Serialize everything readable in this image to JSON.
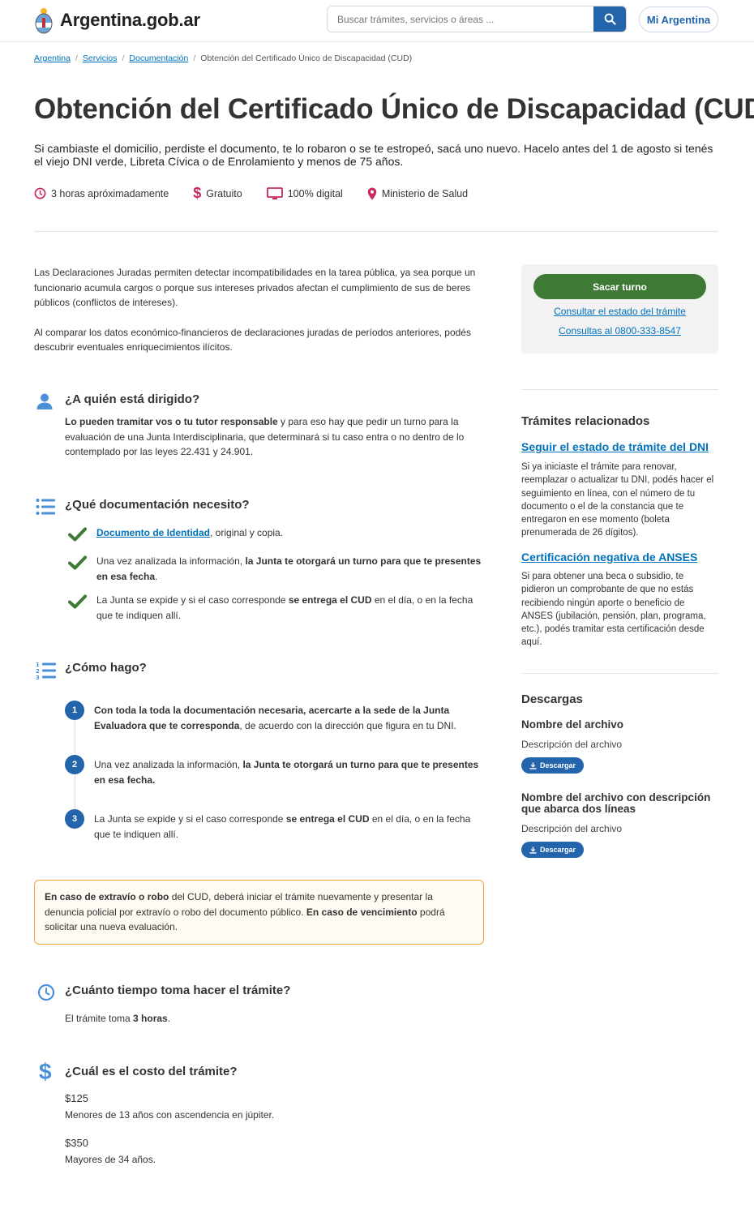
{
  "header": {
    "logo_text": "Argentina.gob.ar",
    "search_placeholder": "Buscar trámites, servicios o áreas ...",
    "mi_argentina": "Mi Argentina"
  },
  "breadcrumb": [
    "Argentina",
    "Servicios",
    "Documentación",
    "Obtención del Certificado Único de Discapacidad (CUD)"
  ],
  "page": {
    "title": "Obtención del Certificado Único de Discapacidad (CUD)",
    "lead": "Si cambiaste el domicilio, perdiste el documento, te lo robaron o se te estropeó, sacá uno nuevo. Hacelo antes del 1 de agosto si tenés el viejo DNI verde, Libreta Cívica o de Enrolamiento y menos de 75 años.",
    "meta": {
      "time": "3 horas apróximadamente",
      "cost": "Gratuito",
      "digital": "100% digital",
      "organism": "Ministerio de Salud"
    },
    "intro_1": "Las Declaraciones Juradas permiten detectar incompatibilidades en la tarea pública, ya sea porque un funcionario acumula cargos o porque sus intereses privados afectan el cumplimiento de sus de beres públicos (conflictos de intereses).",
    "intro_2": "Al comparar los datos económico-financieros de declaraciones juradas de períodos anteriores, podés descubrir eventuales enriquecimientos ilícitos."
  },
  "actions": {
    "primary": "Sacar turno",
    "link_1": "Consultar el estado del trámite",
    "link_2": "Consultas al 0800-333-8547"
  },
  "dirigido": {
    "title": "¿A quién está dirigido?",
    "bold": "Lo pueden tramitar vos o tu tutor responsable",
    "text": " y para eso hay que pedir un turno para la evaluación de una Junta Interdisciplinaria, que determinará si tu caso entra o no dentro de lo contemplado por las leyes 22.431 y 24.901."
  },
  "documentacion": {
    "title": "¿Qué documentación necesito?",
    "item_1_link": "Documento de Identidad",
    "item_1_text": ", original y copia.",
    "item_2_a": "Una vez analizada la información, ",
    "item_2_b": "la Junta te otorgará un turno para que te presentes en esa fecha",
    "item_2_c": ".",
    "item_3_a": "La Junta se expide y si el caso corresponde ",
    "item_3_b": "se entrega el CUD",
    "item_3_c": " en el día, o en la fecha que te indiquen allí."
  },
  "como": {
    "title": "¿Cómo hago?",
    "step_1_num": "1",
    "step_1_b": "Con toda la toda la documentación necesaria, acercarte a la sede de la Junta Evaluadora que te corresponda",
    "step_1_c": ", de acuerdo con la dirección que figura en tu DNI.",
    "step_2_num": "2",
    "step_2_a": "Una vez analizada la información, ",
    "step_2_b": "la Junta te otorgará un turno para que te presentes en esa fecha.",
    "step_3_num": "3",
    "step_3_a": "La Junta se expide y si el caso corresponde ",
    "step_3_b": "se entrega el CUD",
    "step_3_c": " en el día, o en la fecha que te indiquen allí."
  },
  "alert": {
    "b1": "En caso de extravío o robo",
    "t1": " del CUD, deberá iniciar el trámite nuevamente y presentar la denuncia policial por extravío o robo del documento público. ",
    "b2": "En caso de vencimiento",
    "t2": " podrá solicitar una nueva evaluación."
  },
  "tiempo": {
    "title": "¿Cuánto tiempo toma hacer el trámite?",
    "text": "El trámite toma ",
    "bold": "3 horas",
    "end": "."
  },
  "costo": {
    "title": "¿Cuál es el costo del trámite?",
    "price_1": "$125",
    "desc_1": "Menores de 13 años con ascendencia en júpiter.",
    "price_2": "$350",
    "desc_2": "Mayores de 34 años."
  },
  "sidebar": {
    "related_title": "Trámites relacionados",
    "rel_1_link": "Seguir el estado de trámite del DNI",
    "rel_1_text": "Si ya iniciaste el trámite para renovar, reemplazar o actualizar tu DNI, podés hacer el seguimiento en línea, con el número de tu documento o el de la constancia que te entregaron en ese momento (boleta prenumerada de 26 dígitos).",
    "rel_2_link": "Certificación negativa de ANSES",
    "rel_2_text": "Si para obtener una beca o subsidio, te pidieron un comprobante de que no estás recibiendo ningún aporte o beneficio de ANSES (jubilación, pensión, plan, programa, etc.), podés tramitar esta certificación desde aquí.",
    "downloads_title": "Descargas",
    "file_1_name": "Nombre del archivo",
    "file_1_desc": "Descripción del archivo",
    "file_2_name": "Nombre del archivo con descripción que abarca dos líneas",
    "file_2_desc": "Descripción del archivo",
    "download_label": "Descargar"
  },
  "colors": {
    "primary": "#2364aa",
    "success": "#3e7a36",
    "alert_border": "#f0a53a",
    "icon_red": "#c62a5c"
  }
}
